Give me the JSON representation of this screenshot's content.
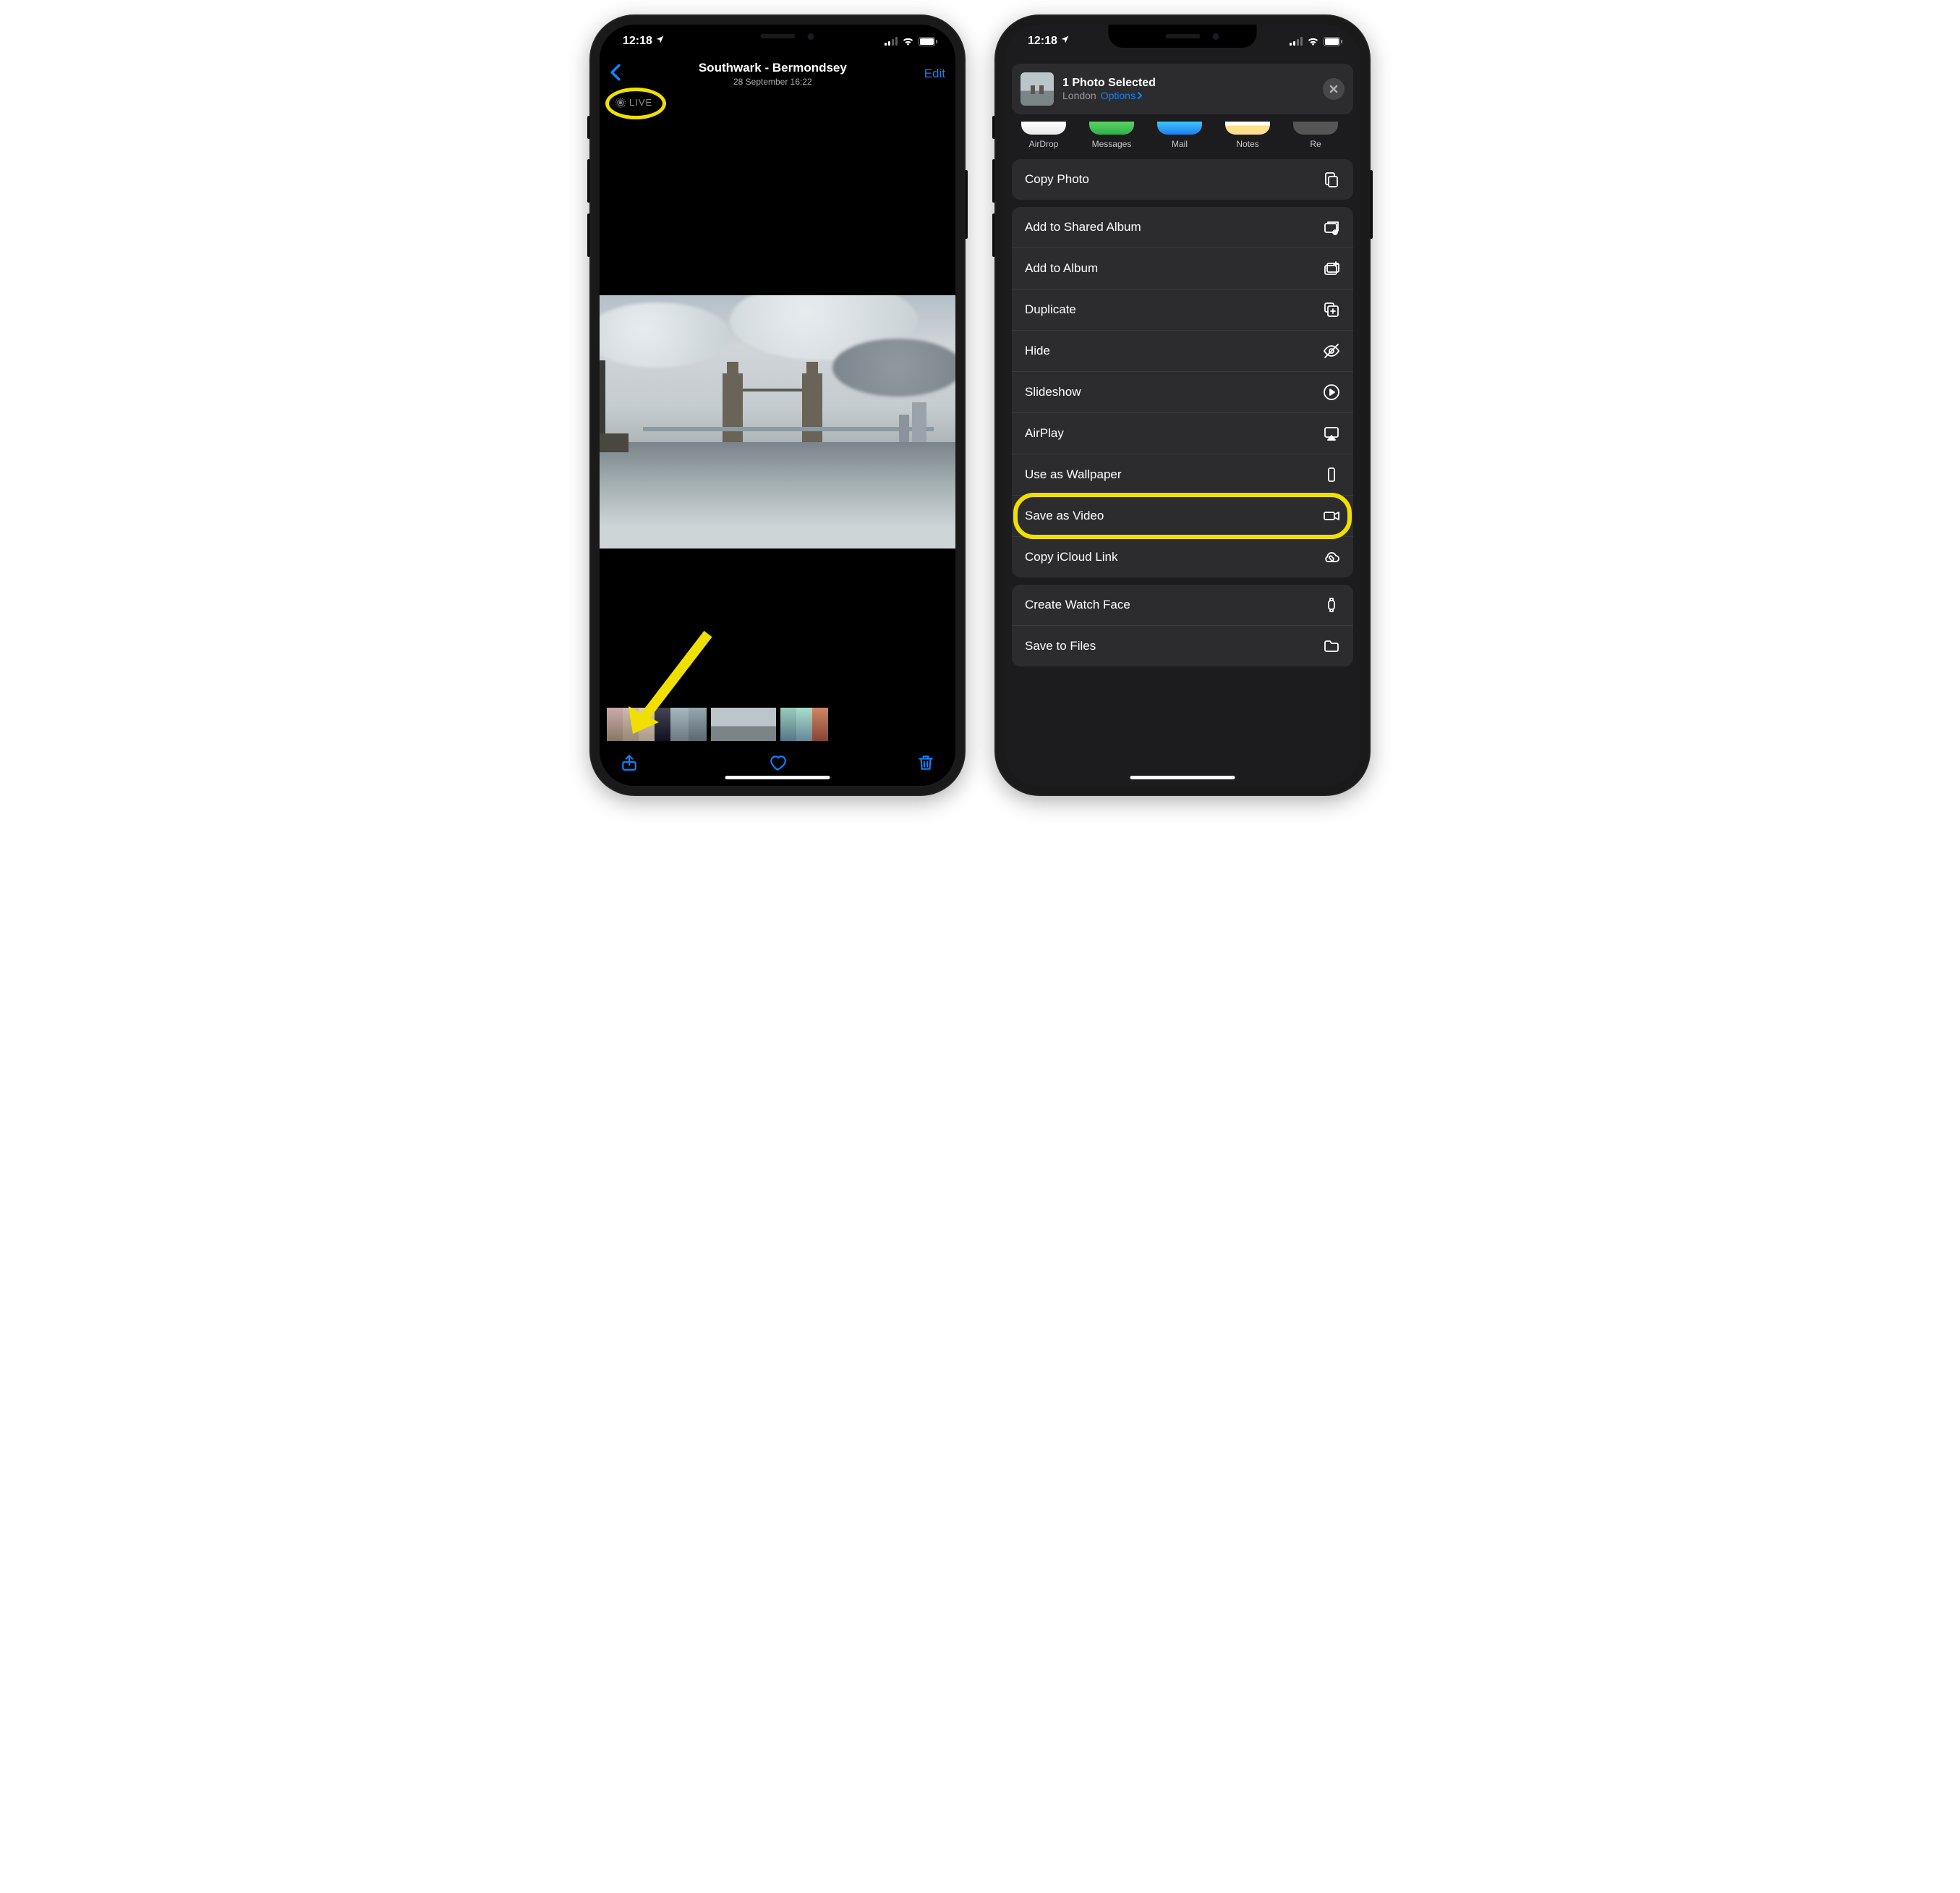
{
  "status": {
    "time": "12:18",
    "location_arrow": "➤"
  },
  "phone1": {
    "title": "Southwark - Bermondsey",
    "subtitle": "28 September  16:22",
    "edit": "Edit",
    "live_label": "LIVE"
  },
  "phone2": {
    "header": {
      "title": "1 Photo Selected",
      "location": "London",
      "options": "Options"
    },
    "apps": [
      {
        "label": "AirDrop",
        "bg": "linear-gradient(#ffffff,#e8e8e8)"
      },
      {
        "label": "Messages",
        "bg": "linear-gradient(#5ed162,#2bb14b)"
      },
      {
        "label": "Mail",
        "bg": "linear-gradient(#3fc6ff,#1c7df0)"
      },
      {
        "label": "Notes",
        "bg": "linear-gradient(#fff 30%,#ffe08a 31%)"
      },
      {
        "label": "Re",
        "bg": "#555"
      }
    ],
    "group1": [
      {
        "label": "Copy Photo",
        "icon": "copy"
      }
    ],
    "group2": [
      {
        "label": "Add to Shared Album",
        "icon": "shared-album"
      },
      {
        "label": "Add to Album",
        "icon": "album"
      },
      {
        "label": "Duplicate",
        "icon": "duplicate"
      },
      {
        "label": "Hide",
        "icon": "hide"
      },
      {
        "label": "Slideshow",
        "icon": "play"
      },
      {
        "label": "AirPlay",
        "icon": "airplay"
      },
      {
        "label": "Use as Wallpaper",
        "icon": "wallpaper"
      },
      {
        "label": "Save as Video",
        "icon": "video",
        "highlight": true
      },
      {
        "label": "Copy iCloud Link",
        "icon": "cloud"
      }
    ],
    "group3": [
      {
        "label": "Create Watch Face",
        "icon": "watch"
      },
      {
        "label": "Save to Files",
        "icon": "folder"
      }
    ]
  }
}
